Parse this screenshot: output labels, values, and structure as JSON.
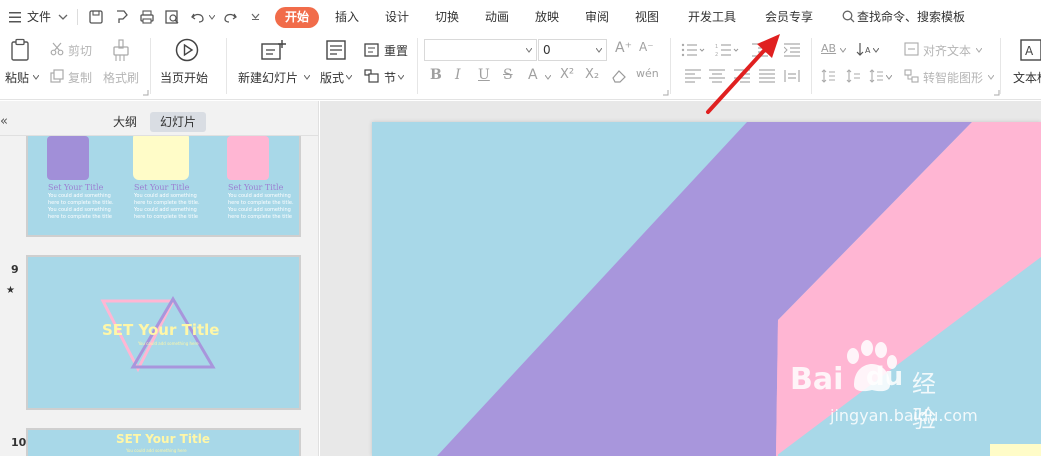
{
  "menubar": {
    "hamburger_icon": "menu-icon",
    "file_label": "文件",
    "tabs": [
      "开始",
      "插入",
      "设计",
      "切换",
      "动画",
      "放映",
      "审阅",
      "视图",
      "开发工具",
      "会员专享"
    ],
    "active_tab": "开始",
    "search_label": "查找命令、搜索模板",
    "accent": "#f16c4a"
  },
  "ribbon": {
    "paste_label": "粘贴",
    "cut_label": "剪切",
    "copy_label": "复制",
    "format_painter_label": "格式刷",
    "play_from_current_label": "当页开始",
    "new_slide_label": "新建幻灯片",
    "layout_label": "版式",
    "reset_label": "重置",
    "section_label": "节",
    "font_name_value": "",
    "font_size_value": "0",
    "align_text_label": "对齐文本",
    "smart_shape_label": "转智能图形",
    "textbox_label": "文本框"
  },
  "panel": {
    "tab_outline": "大纲",
    "tab_slides": "幻灯片",
    "collapse_icon": "double-chevron-left-icon",
    "slides": [
      {
        "number": "",
        "items": [
          {
            "title": "Set Your Title",
            "body": "You could add something here to complete the title. You could add something here to complete the title",
            "color": "#a18fd8"
          },
          {
            "title": "Set Your Title",
            "body": "You could add something here to complete the title. You could add something here to complete the title",
            "color": "#fffcc8"
          },
          {
            "title": "Set Your Title",
            "body": "You could add something here to complete the title. You could add something here to complete the title",
            "color": "#ffb6d3"
          }
        ]
      },
      {
        "number": "9",
        "star": "★",
        "title": "SET Your Title",
        "subtitle": "You could add something here"
      },
      {
        "number": "10",
        "title": "SET Your Title",
        "subtitle": "You could add something here"
      }
    ]
  },
  "slide": {
    "bg": "#a8d8e8",
    "purple": "#a896dc",
    "pink": "#ffb6d3"
  },
  "watermark": {
    "brand": "Bai",
    "brand2": "du",
    "cn": "经验",
    "url": "jingyan.baidu.com"
  }
}
